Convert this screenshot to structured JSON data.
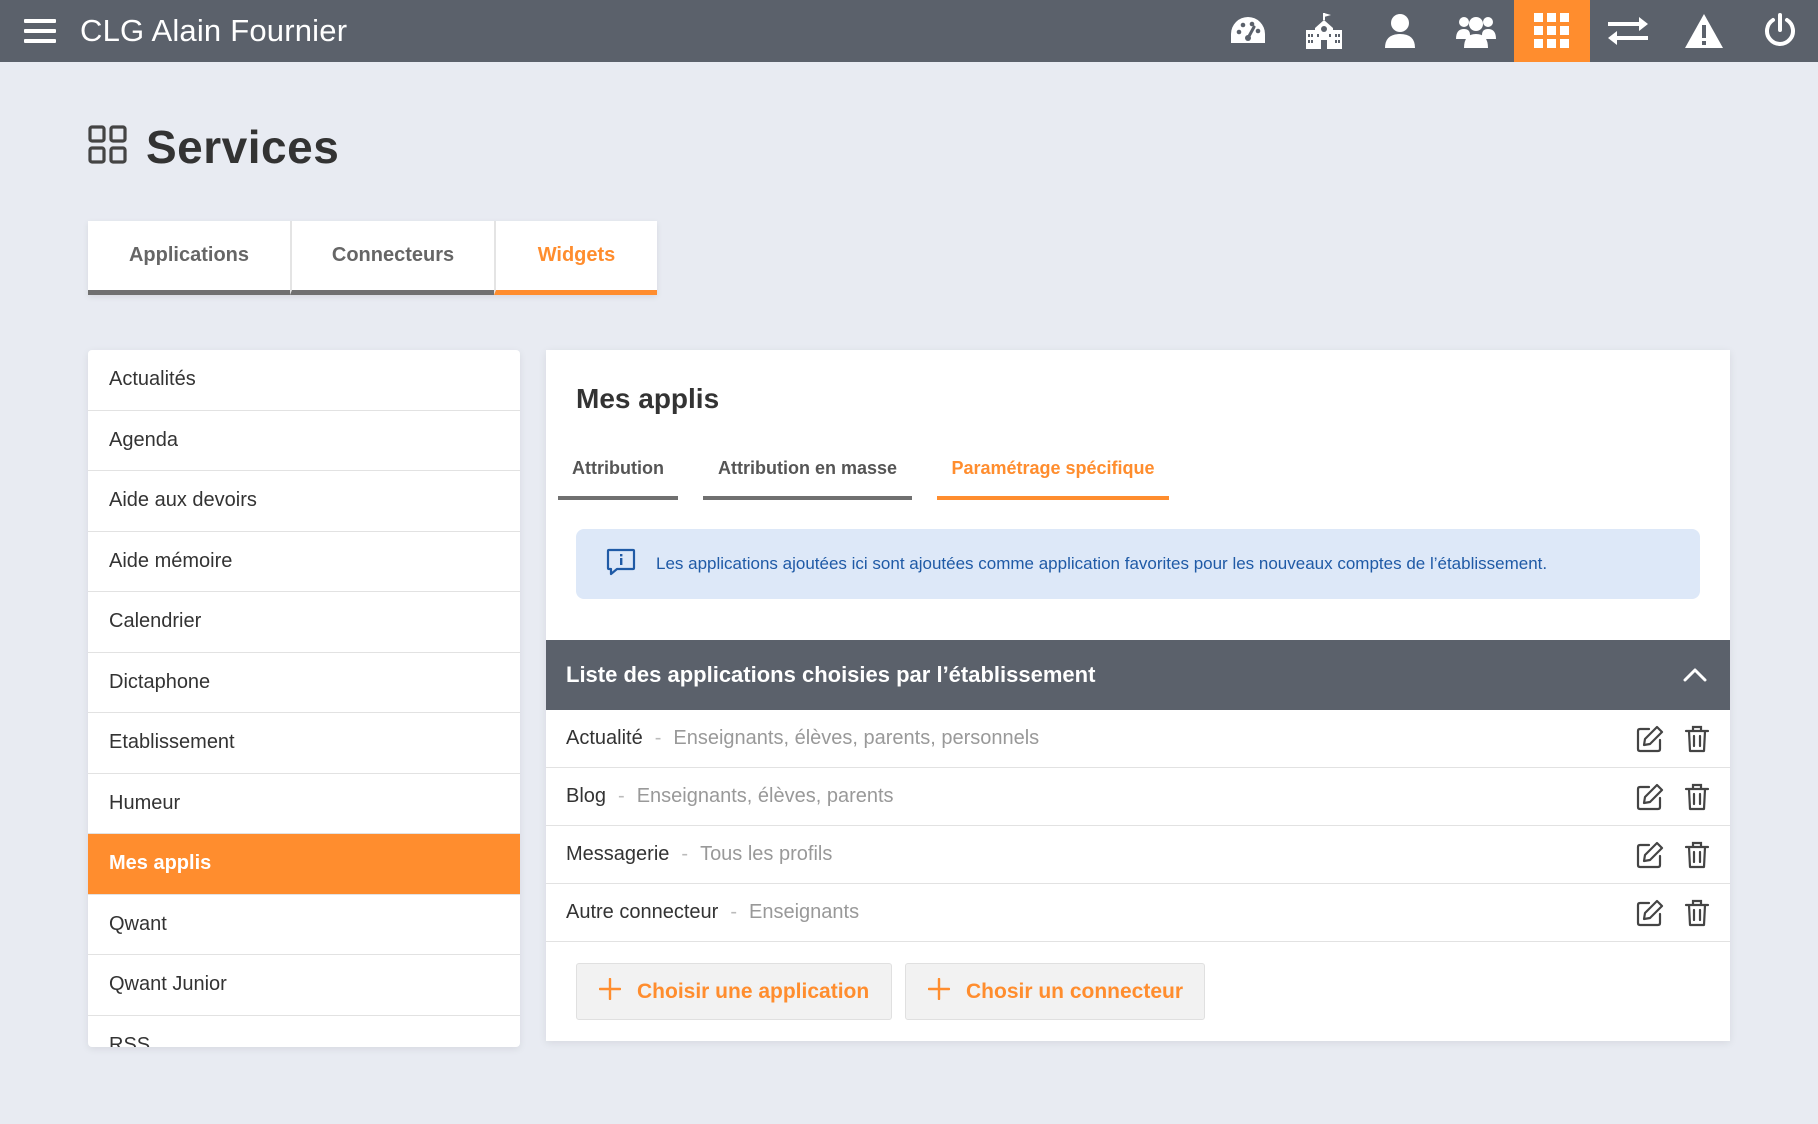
{
  "colors": {
    "accent": "#ff8d2e",
    "topbar": "#5b616b",
    "background": "#e8ebf2",
    "info_bg": "#dde8f8",
    "info_text": "#1f5aa6"
  },
  "header": {
    "title": "CLG Alain Fournier",
    "menu_icon": "hamburger-menu-icon",
    "icons": [
      "dashboard-icon",
      "school-icon",
      "user-icon",
      "group-icon",
      "apps-grid-icon",
      "transfer-icon",
      "alert-icon",
      "power-icon"
    ],
    "active_icon": "apps-grid-icon"
  },
  "page": {
    "title": "Services",
    "icon": "services-grid-icon"
  },
  "main_tabs": [
    {
      "label": "Applications",
      "active": false
    },
    {
      "label": "Connecteurs",
      "active": false
    },
    {
      "label": "Widgets",
      "active": true
    }
  ],
  "sidebar": {
    "items": [
      {
        "label": "Actualités"
      },
      {
        "label": "Agenda"
      },
      {
        "label": "Aide aux devoirs"
      },
      {
        "label": "Aide mémoire"
      },
      {
        "label": "Calendrier"
      },
      {
        "label": "Dictaphone"
      },
      {
        "label": "Etablissement"
      },
      {
        "label": "Humeur"
      },
      {
        "label": "Mes applis",
        "active": true
      },
      {
        "label": "Qwant"
      },
      {
        "label": "Qwant Junior"
      },
      {
        "label": "RSS"
      }
    ]
  },
  "panel": {
    "title": "Mes applis",
    "sub_tabs": [
      {
        "label": "Attribution"
      },
      {
        "label": "Attribution en masse"
      },
      {
        "label": "Paramétrage spécifique",
        "active": true
      }
    ],
    "info": "Les applications ajoutées ici sont ajoutées comme application favorites pour les nouveaux comptes de l’établissement.",
    "list_title": "Liste des applications choisies par l’établissement",
    "separator": "-",
    "rows": [
      {
        "name": "Actualité",
        "profiles": "Enseignants, élèves, parents, personnels"
      },
      {
        "name": "Blog",
        "profiles": "Enseignants, élèves, parents"
      },
      {
        "name": "Messagerie",
        "profiles": "Tous les profils"
      },
      {
        "name": "Autre connecteur",
        "profiles": "Enseignants"
      }
    ],
    "add_application": "Choisir une application",
    "add_connector": "Chosir un connecteur"
  }
}
